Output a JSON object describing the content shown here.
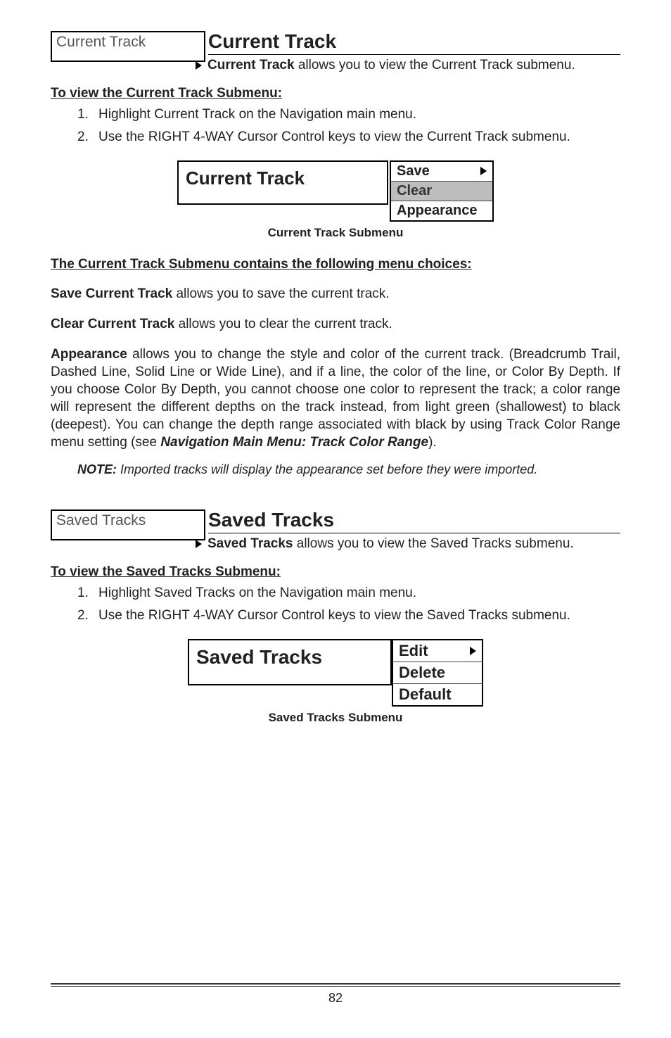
{
  "section1": {
    "menu_box_label": "Current Track",
    "title": "Current Track",
    "intro_bold": "Current Track",
    "intro_rest": " allows you to view the Current Track submenu.",
    "sub_heading": "To view the Current Track Submenu:",
    "steps": [
      "Highlight Current Track on the Navigation main menu.",
      "Use the RIGHT 4-WAY Cursor Control keys to view the Current Track submenu."
    ],
    "fig_box_label": "Current Track",
    "submenu_rows": [
      "Save",
      "Clear",
      "Appearance"
    ],
    "submenu_caption": "Current Track Submenu",
    "choices_heading": "The Current Track Submenu contains the following menu choices:",
    "p_save_bold": "Save Current Track",
    "p_save_rest": " allows you to save the current track.",
    "p_clear_bold": "Clear Current Track",
    "p_clear_rest": " allows you to clear the current track.",
    "p_app_bold": "Appearance",
    "p_app_rest_a": " allows you to change the style and color of the current track. (Breadcrumb Trail, Dashed Line, Solid Line or Wide Line), and if a line, the color of the line, or Color By Depth. If you choose Color By Depth, you cannot choose one color to represent the track; a color range will represent the different depths on the track instead, from light green (shallowest) to black (deepest). You can change the depth range associated with black by using Track Color Range menu setting (see ",
    "p_app_rest_ital": "Navigation Main Menu: Track Color Range",
    "p_app_rest_b": ").",
    "note_label": "NOTE:",
    "note_text": " Imported tracks will display the appearance set before they were imported."
  },
  "section2": {
    "menu_box_label": "Saved Tracks",
    "title": "Saved Tracks",
    "intro_bold": "Saved Tracks",
    "intro_rest": " allows you to view the Saved Tracks submenu.",
    "sub_heading": "To view the Saved Tracks Submenu:",
    "steps": [
      "Highlight Saved Tracks on the Navigation main menu.",
      "Use the RIGHT 4-WAY Cursor Control keys to view the Saved Tracks submenu."
    ],
    "fig_box_label": "Saved Tracks",
    "submenu_rows": [
      "Edit",
      "Delete",
      "Default"
    ],
    "submenu_caption": "Saved Tracks Submenu"
  },
  "page_number": "82"
}
